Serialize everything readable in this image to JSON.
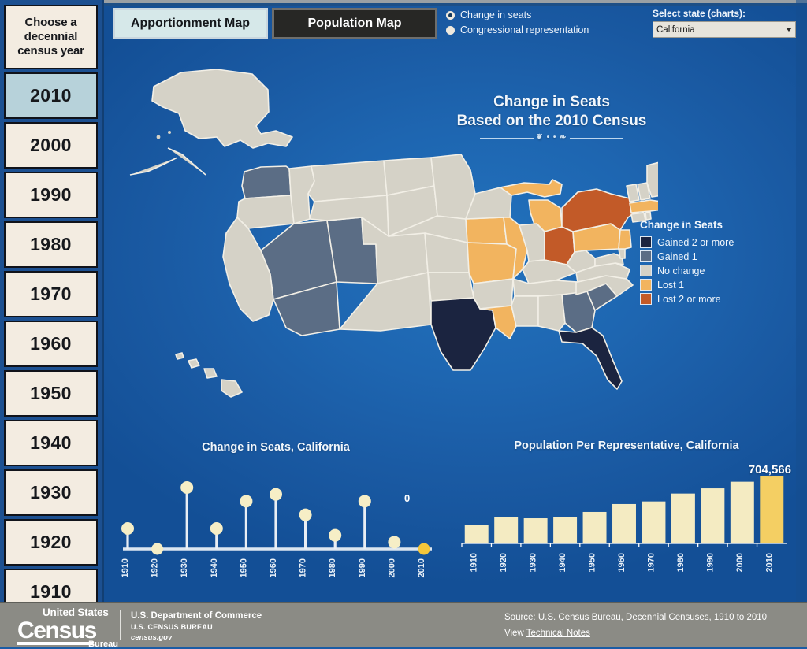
{
  "sidebar": {
    "header": "Choose a decennial census year",
    "header_lines": [
      "Choose a",
      "decennial",
      "census year"
    ],
    "selected_year": "2010",
    "years": [
      "2010",
      "2000",
      "1990",
      "1980",
      "1970",
      "1960",
      "1950",
      "1940",
      "1930",
      "1920",
      "1910"
    ]
  },
  "toolbar": {
    "tab_apportionment": "Apportionment Map",
    "tab_population": "Population Map",
    "active_tab": "Apportionment Map",
    "radios": [
      {
        "label": "Change in seats",
        "selected": true
      },
      {
        "label": "Congressional representation",
        "selected": false
      }
    ],
    "state_select_label": "Select state (charts):",
    "state_select_value": "California"
  },
  "map": {
    "title_line1": "Change in Seats",
    "title_line2": "Based on the 2010 Census",
    "legend_title": "Change in Seats",
    "legend": [
      {
        "label": "Gained 2 or more",
        "color": "#1b2440"
      },
      {
        "label": "Gained 1",
        "color": "#5b6d85"
      },
      {
        "label": "No change",
        "color": "#d5d2c7"
      },
      {
        "label": "Lost 1",
        "color": "#f2b45f"
      },
      {
        "label": "Lost 2 or more",
        "color": "#c25a28"
      }
    ],
    "states": {
      "gained2": [
        "Texas",
        "Florida"
      ],
      "gained1": [
        "Washington",
        "Nevada",
        "Utah",
        "Arizona",
        "Georgia",
        "South Carolina"
      ],
      "lost1": [
        "Iowa",
        "Missouri",
        "Illinois",
        "Michigan",
        "Pennsylvania",
        "New Jersey",
        "Massachusetts",
        "Louisiana"
      ],
      "lost2": [
        "New York",
        "Ohio"
      ]
    }
  },
  "chart_data": [
    {
      "type": "bar",
      "chart_style": "lollipop",
      "title": "Change in Seats, California",
      "xlabel": "",
      "ylabel": "",
      "categories": [
        "1910",
        "1920",
        "1930",
        "1940",
        "1950",
        "1960",
        "1970",
        "1980",
        "1990",
        "2000",
        "2010"
      ],
      "values": [
        3,
        0,
        9,
        3,
        7,
        8,
        5,
        2,
        7,
        1,
        0
      ],
      "ylim": [
        0,
        9
      ],
      "grid": false,
      "annotation": "0",
      "annotation_value": 0,
      "highlight_category": "2010",
      "colors": {
        "stem": "#e9eef4",
        "dot": "#f6eec6",
        "dot_highlight": "#f4c63a",
        "baseline": "#dce6f0"
      }
    },
    {
      "type": "bar",
      "title": "Population Per Representative, California",
      "xlabel": "",
      "ylabel": "",
      "categories": [
        "1910",
        "1920",
        "1930",
        "1940",
        "1950",
        "1960",
        "1970",
        "1980",
        "1990",
        "2000",
        "2010"
      ],
      "values": [
        196000,
        273000,
        262000,
        273000,
        328000,
        410000,
        437000,
        519000,
        573000,
        642000,
        704566
      ],
      "ylim": [
        0,
        704566
      ],
      "grid": false,
      "data_label": "704,566",
      "data_label_category": "2010",
      "highlight_category": "2010",
      "colors": {
        "bar": "#f4ebc2",
        "bar_highlight": "#f4cf63",
        "axis": "#ffffff"
      }
    }
  ],
  "footer": {
    "logo_line1": "United States",
    "logo_line2": "Census",
    "logo_line3": "Bureau",
    "dept_line1": "U.S. Department of Commerce",
    "dept_line2": "U.S. CENSUS BUREAU",
    "dept_line3": "census.gov",
    "source": "Source: U.S. Census Bureau, Decennial Censuses, 1910 to 2010",
    "view_prefix": "View ",
    "technical_notes": "Technical Notes"
  }
}
